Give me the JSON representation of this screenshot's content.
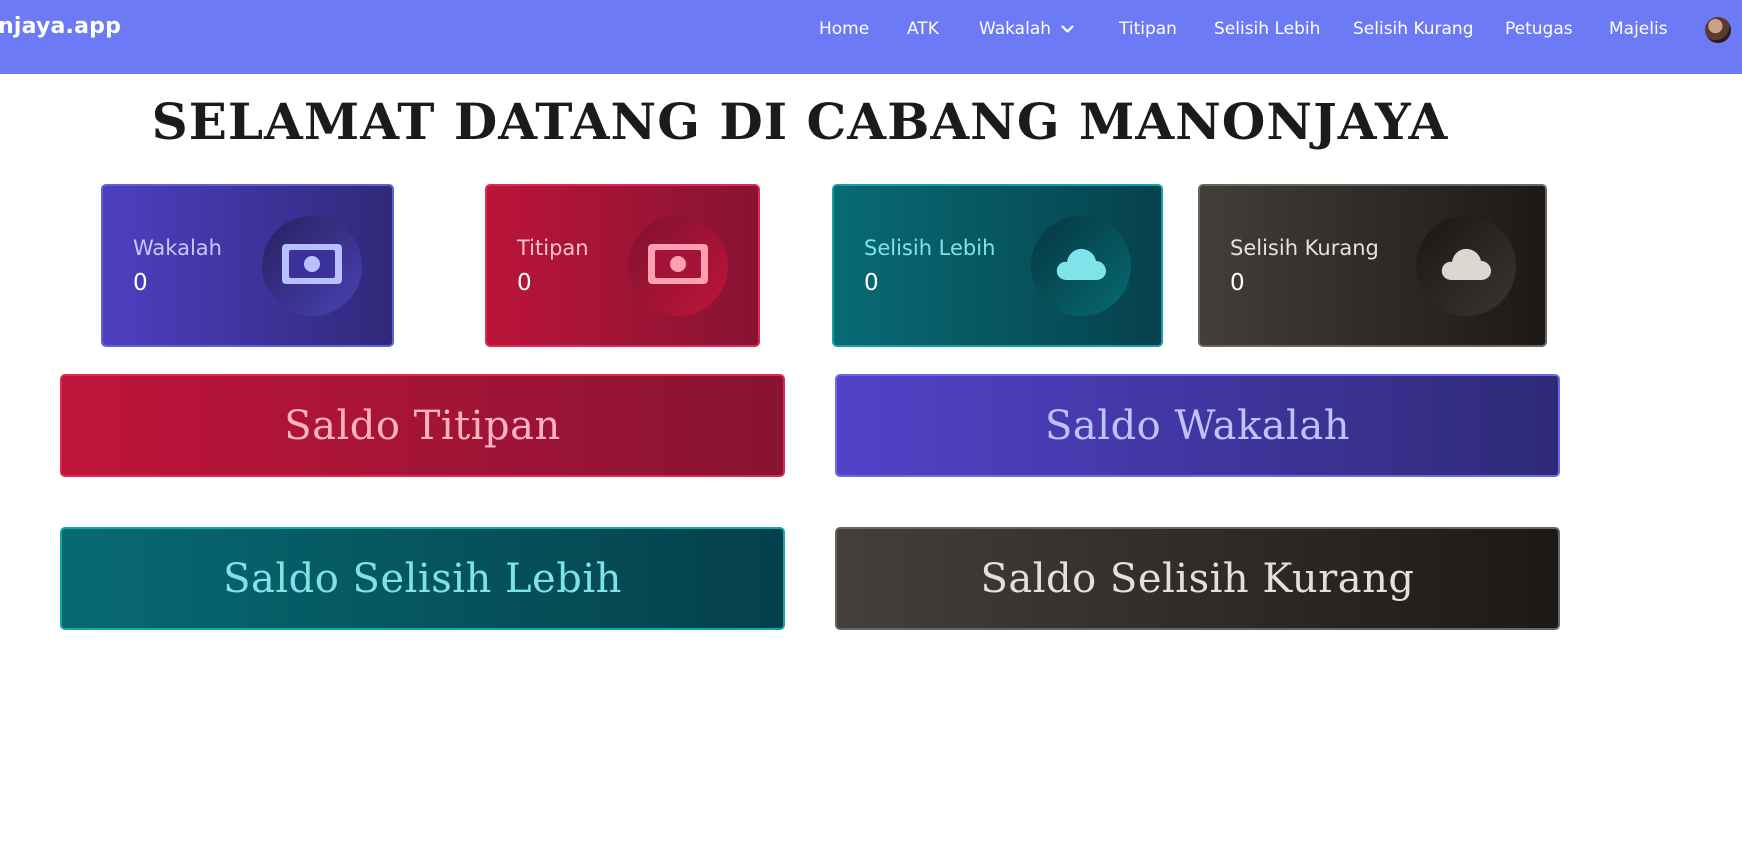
{
  "navbar": {
    "brand": "njaya.app",
    "links": [
      {
        "label": "Home"
      },
      {
        "label": "ATK"
      },
      {
        "label": "Wakalah"
      },
      {
        "label": "Titipan"
      },
      {
        "label": "Selisih Lebih"
      },
      {
        "label": "Selisih Kurang"
      },
      {
        "label": "Petugas"
      },
      {
        "label": "Majelis"
      }
    ],
    "color": "#6c7af5"
  },
  "page": {
    "title": "SELAMAT DATANG DI CABANG MANONJAYA"
  },
  "stats": [
    {
      "label": "Wakalah",
      "value": "0",
      "icon": "money-bill-icon"
    },
    {
      "label": "Titipan",
      "value": "0",
      "icon": "money-bill-icon"
    },
    {
      "label": "Selisih Lebih",
      "value": "0",
      "icon": "cloud-icon"
    },
    {
      "label": "Selisih Kurang",
      "value": "0",
      "icon": "cloud-icon"
    }
  ],
  "saldo_buttons": [
    {
      "label": "Saldo Titipan"
    },
    {
      "label": "Saldo Wakalah"
    },
    {
      "label": "Saldo Selisih Lebih"
    },
    {
      "label": "Saldo Selisih Kurang"
    }
  ]
}
